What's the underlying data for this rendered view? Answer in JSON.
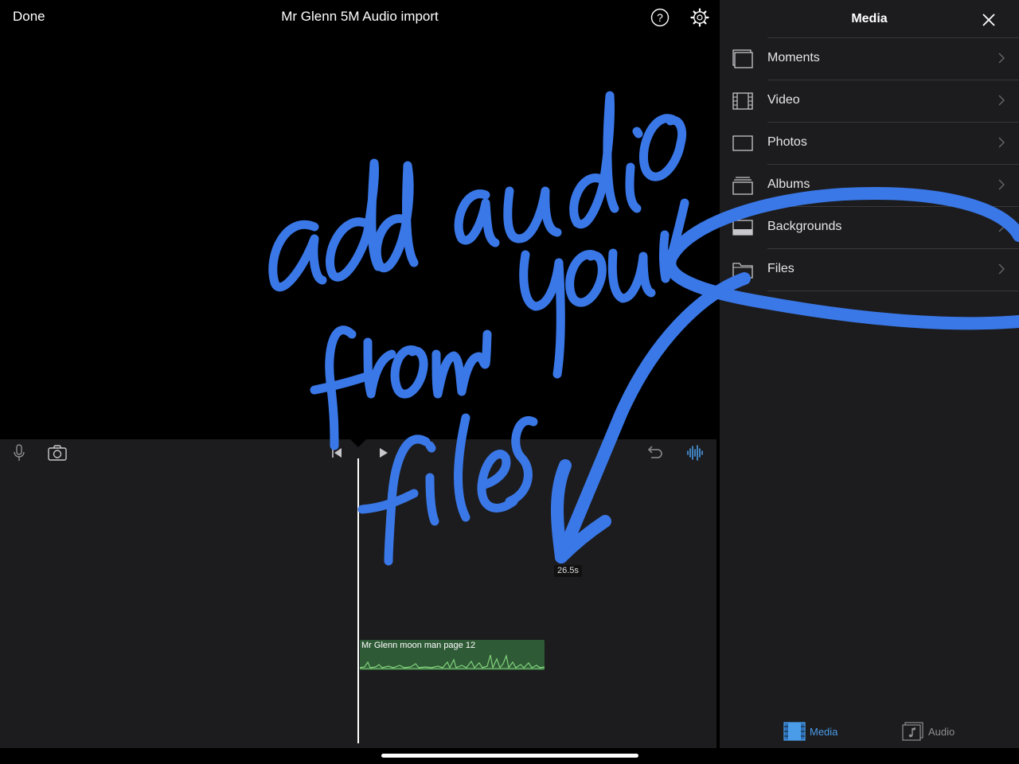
{
  "header": {
    "done_label": "Done",
    "project_title": "Mr Glenn 5M Audio import",
    "help_icon": "question-circle-icon",
    "settings_icon": "gear-icon"
  },
  "timeline": {
    "toolbar_icons": [
      "microphone-icon",
      "camera-icon",
      "skip-to-start-icon",
      "play-icon",
      "undo-icon",
      "audio-waveform-icon"
    ],
    "duration": "26.5s",
    "audio_clip": {
      "label": "Mr Glenn moon man page 12",
      "color": "#2f5a36"
    }
  },
  "media_panel": {
    "title": "Media",
    "close_icon": "close-icon",
    "items": [
      {
        "label": "Moments",
        "icon": "moments-icon"
      },
      {
        "label": "Video",
        "icon": "film-strip-icon"
      },
      {
        "label": "Photos",
        "icon": "photo-frame-icon"
      },
      {
        "label": "Albums",
        "icon": "albums-icon"
      },
      {
        "label": "Backgrounds",
        "icon": "backgrounds-icon"
      },
      {
        "label": "Files",
        "icon": "folder-icon"
      }
    ],
    "tabs": [
      {
        "label": "Media",
        "icon": "film-strip-icon",
        "selected": true
      },
      {
        "label": "Audio",
        "icon": "music-note-icon",
        "selected": false
      }
    ],
    "accent_color": "#4a9be8"
  },
  "annotation": {
    "color": "#3a78e8"
  }
}
